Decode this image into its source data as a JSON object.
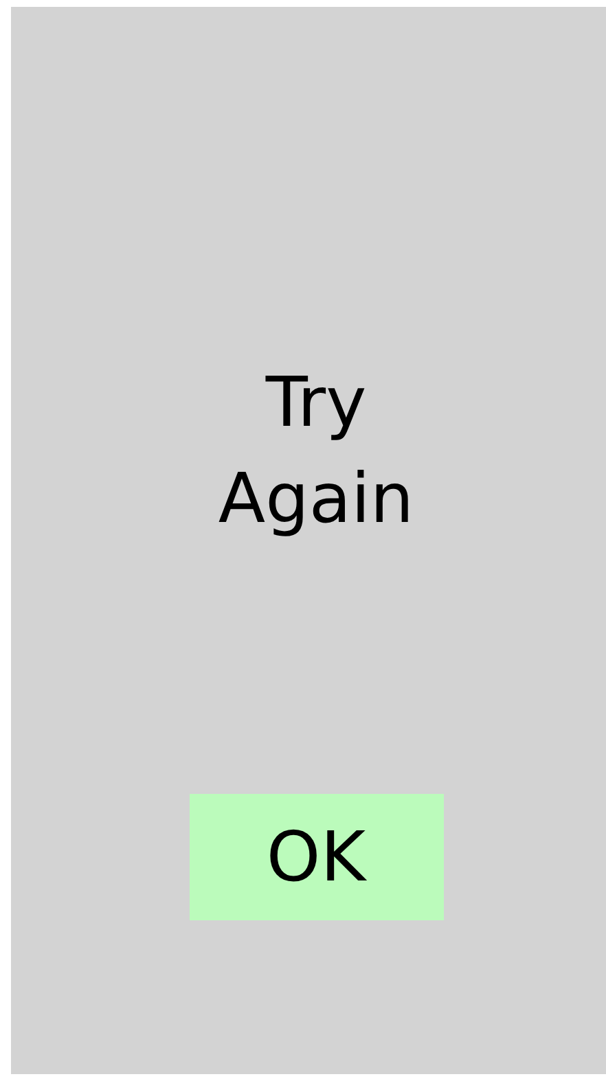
{
  "message": "Try Again",
  "button": {
    "label": "OK"
  }
}
